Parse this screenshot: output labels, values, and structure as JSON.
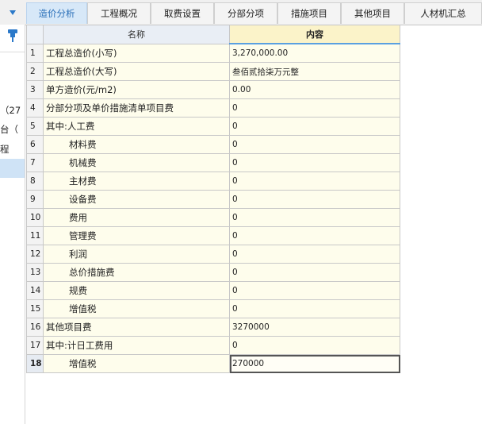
{
  "tabs": [
    {
      "label": "造价分析",
      "active": true
    },
    {
      "label": "工程概况",
      "active": false
    },
    {
      "label": "取费设置",
      "active": false
    },
    {
      "label": "分部分项",
      "active": false
    },
    {
      "label": "措施项目",
      "active": false
    },
    {
      "label": "其他项目",
      "active": false
    },
    {
      "label": "人材机汇总",
      "active": false
    }
  ],
  "left_panel": {
    "texts": [
      "（27",
      "台（",
      "程"
    ]
  },
  "grid": {
    "headers": {
      "name": "名称",
      "content": "内容"
    },
    "rows": [
      {
        "idx": "1",
        "name": "工程总造价(小写)",
        "value": "3,270,000.00",
        "indent": false
      },
      {
        "idx": "2",
        "name": "工程总造价(大写)",
        "value": "叁佰贰拾柒万元整",
        "indent": false
      },
      {
        "idx": "3",
        "name": "单方造价(元/m2)",
        "value": "0.00",
        "indent": false
      },
      {
        "idx": "4",
        "name": "分部分项及单价措施清单项目费",
        "value": "0",
        "indent": false
      },
      {
        "idx": "5",
        "name": "其中:人工费",
        "value": "0",
        "indent": false
      },
      {
        "idx": "6",
        "name": "材料费",
        "value": "0",
        "indent": true
      },
      {
        "idx": "7",
        "name": "机械费",
        "value": "0",
        "indent": true
      },
      {
        "idx": "8",
        "name": "主材费",
        "value": "0",
        "indent": true
      },
      {
        "idx": "9",
        "name": "设备费",
        "value": "0",
        "indent": true
      },
      {
        "idx": "10",
        "name": "费用",
        "value": "0",
        "indent": true
      },
      {
        "idx": "11",
        "name": "管理费",
        "value": "0",
        "indent": true
      },
      {
        "idx": "12",
        "name": "利润",
        "value": "0",
        "indent": true
      },
      {
        "idx": "13",
        "name": "总价措施费",
        "value": "0",
        "indent": true
      },
      {
        "idx": "14",
        "name": "规费",
        "value": "0",
        "indent": true
      },
      {
        "idx": "15",
        "name": "增值税",
        "value": "0",
        "indent": true
      },
      {
        "idx": "16",
        "name": "其他项目费",
        "value": "3270000",
        "indent": false
      },
      {
        "idx": "17",
        "name": "其中:计日工费用",
        "value": "0",
        "indent": false
      },
      {
        "idx": "18",
        "name": "增值税",
        "value": "270000",
        "indent": true,
        "selected": true
      }
    ]
  },
  "colors": {
    "accent": "#2b79c9",
    "active_tab_bg": "#d7e8f8",
    "cell_bg": "#fefdec",
    "header_value_bg": "#fbf3c9"
  }
}
